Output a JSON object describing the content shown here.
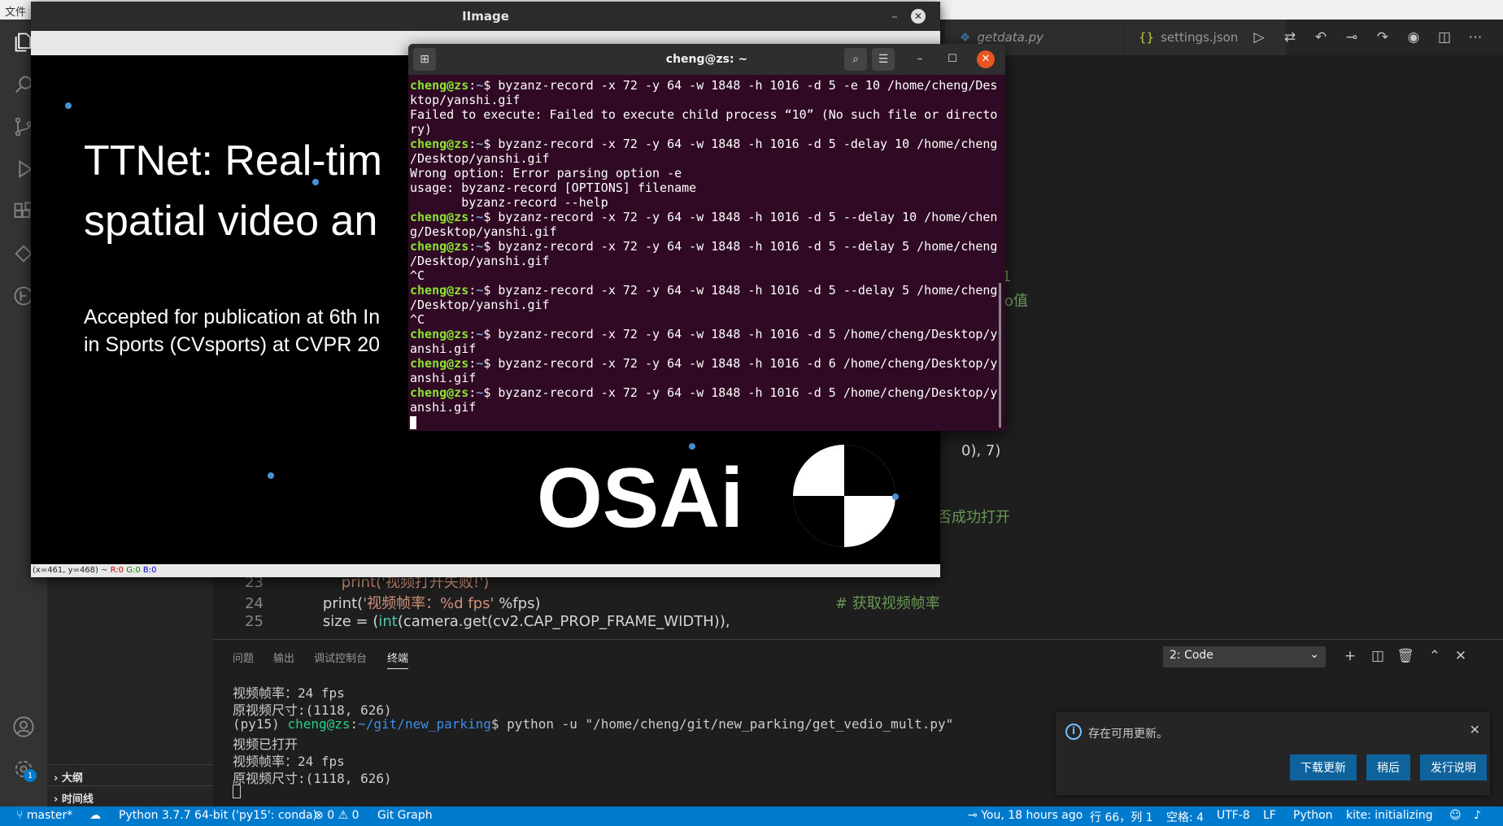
{
  "menubar": {
    "label": "文件"
  },
  "vscode": {
    "tabs": [
      {
        "label": "getdata.py",
        "icon": "python-icon"
      },
      {
        "label": "settings.json",
        "icon": "braces-icon"
      }
    ],
    "activity_badge": "1",
    "sidebar": {
      "sections": [
        "大纲",
        "时间线"
      ]
    },
    "code_fragments": {
      "frag1": "1",
      "frag2": "ro值",
      "frag3": "0), 7)",
      "frag4": "否成功打开"
    },
    "code_lines": [
      {
        "num": "23",
        "text": "        print('视频打开失败!')"
      },
      {
        "num": "24",
        "pre": "    print(",
        "str": "'视频帧率：%d fps'",
        "post": " %fps)",
        "comment": "# 获取视频帧率"
      },
      {
        "num": "25",
        "pre": "    size = (",
        "fn": "int",
        "post": "(camera.get(cv2.CAP_PROP_FRAME_WIDTH)),"
      }
    ],
    "panel": {
      "tabs": [
        "问题",
        "输出",
        "调试控制台",
        "终端"
      ],
      "active_tab": "终端",
      "terminal_select": "2: Code",
      "lines": [
        "视频帧率：24 fps",
        "原视频尺寸:(1118, 626)"
      ],
      "prompt_env": "(py15) ",
      "prompt_user": "cheng@zs",
      "prompt_path": "~/git/new_parking",
      "prompt_cmd": "$ python -u \"/home/cheng/git/new_parking/get_vedio_mult.py\"",
      "after_lines": [
        "视频已打开",
        "视频帧率：24 fps",
        "原视频尺寸:(1118, 626)"
      ]
    },
    "notification": {
      "message": "存在可用更新。",
      "buttons": [
        "下载更新",
        "稍后",
        "发行说明"
      ]
    },
    "statusbar": {
      "branch": "master*",
      "interpreter": "Python 3.7.7 64-bit ('py15': conda)",
      "errors": "0",
      "warnings": "0",
      "git_graph": "Git Graph",
      "blame": "You, 18 hours ago",
      "position": "行 66，列 1",
      "spaces": "空格: 4",
      "encoding": "UTF-8",
      "eol": "LF",
      "language": "Python",
      "kite": "kite: initializing"
    }
  },
  "image_window": {
    "title": "IImage",
    "slide": {
      "title_line1": "TTNet: Real-tim",
      "title_line2": "spatial video an",
      "sub_line1": "Accepted for publication at 6th In",
      "sub_line2": "in Sports (CVsports) at CVPR 20",
      "logo_text": "OSAi"
    },
    "status": {
      "coords": "(x=461, y=468) ~ ",
      "r": "R:0",
      "g": "G:0",
      "b": "B:0"
    }
  },
  "terminal": {
    "title": "cheng@zs: ~",
    "rows": [
      {
        "p": true,
        "t": " byzanz-record -x 72 -y 64 -w 1848 -h 1016 -d 5 -e 10 /home/cheng/Des"
      },
      {
        "p": false,
        "t": "ktop/yanshi.gif"
      },
      {
        "p": false,
        "t": "Failed to execute: Failed to execute child process “10” (No such file or directo"
      },
      {
        "p": false,
        "t": "ry)"
      },
      {
        "p": true,
        "t": " byzanz-record -x 72 -y 64 -w 1848 -h 1016 -d 5 -delay 10 /home/cheng"
      },
      {
        "p": false,
        "t": "/Desktop/yanshi.gif"
      },
      {
        "p": false,
        "t": "Wrong option: Error parsing option -e"
      },
      {
        "p": false,
        "t": "usage: byzanz-record [OPTIONS] filename"
      },
      {
        "p": false,
        "t": "       byzanz-record --help"
      },
      {
        "p": true,
        "t": " byzanz-record -x 72 -y 64 -w 1848 -h 1016 -d 5 --delay 10 /home/chen"
      },
      {
        "p": false,
        "t": "g/Desktop/yanshi.gif"
      },
      {
        "p": true,
        "t": " byzanz-record -x 72 -y 64 -w 1848 -h 1016 -d 5 --delay 5 /home/cheng"
      },
      {
        "p": false,
        "t": "/Desktop/yanshi.gif"
      },
      {
        "p": false,
        "t": "^C"
      },
      {
        "p": true,
        "t": " byzanz-record -x 72 -y 64 -w 1848 -h 1016 -d 5 --delay 5 /home/cheng"
      },
      {
        "p": false,
        "t": "/Desktop/yanshi.gif"
      },
      {
        "p": false,
        "t": "^C"
      },
      {
        "p": true,
        "t": " byzanz-record -x 72 -y 64 -w 1848 -h 1016 -d 5 /home/cheng/Desktop/y"
      },
      {
        "p": false,
        "t": "anshi.gif"
      },
      {
        "p": true,
        "t": " byzanz-record -x 72 -y 64 -w 1848 -h 1016 -d 6 /home/cheng/Desktop/y"
      },
      {
        "p": false,
        "t": "anshi.gif"
      },
      {
        "p": true,
        "t": " byzanz-record -x 72 -y 64 -w 1848 -h 1016 -d 5 /home/cheng/Desktop/y"
      },
      {
        "p": false,
        "t": "anshi.gif"
      }
    ],
    "prompt_user": "cheng@zs",
    "prompt_sep": ":",
    "prompt_path": "~",
    "prompt_dollar": "$"
  }
}
